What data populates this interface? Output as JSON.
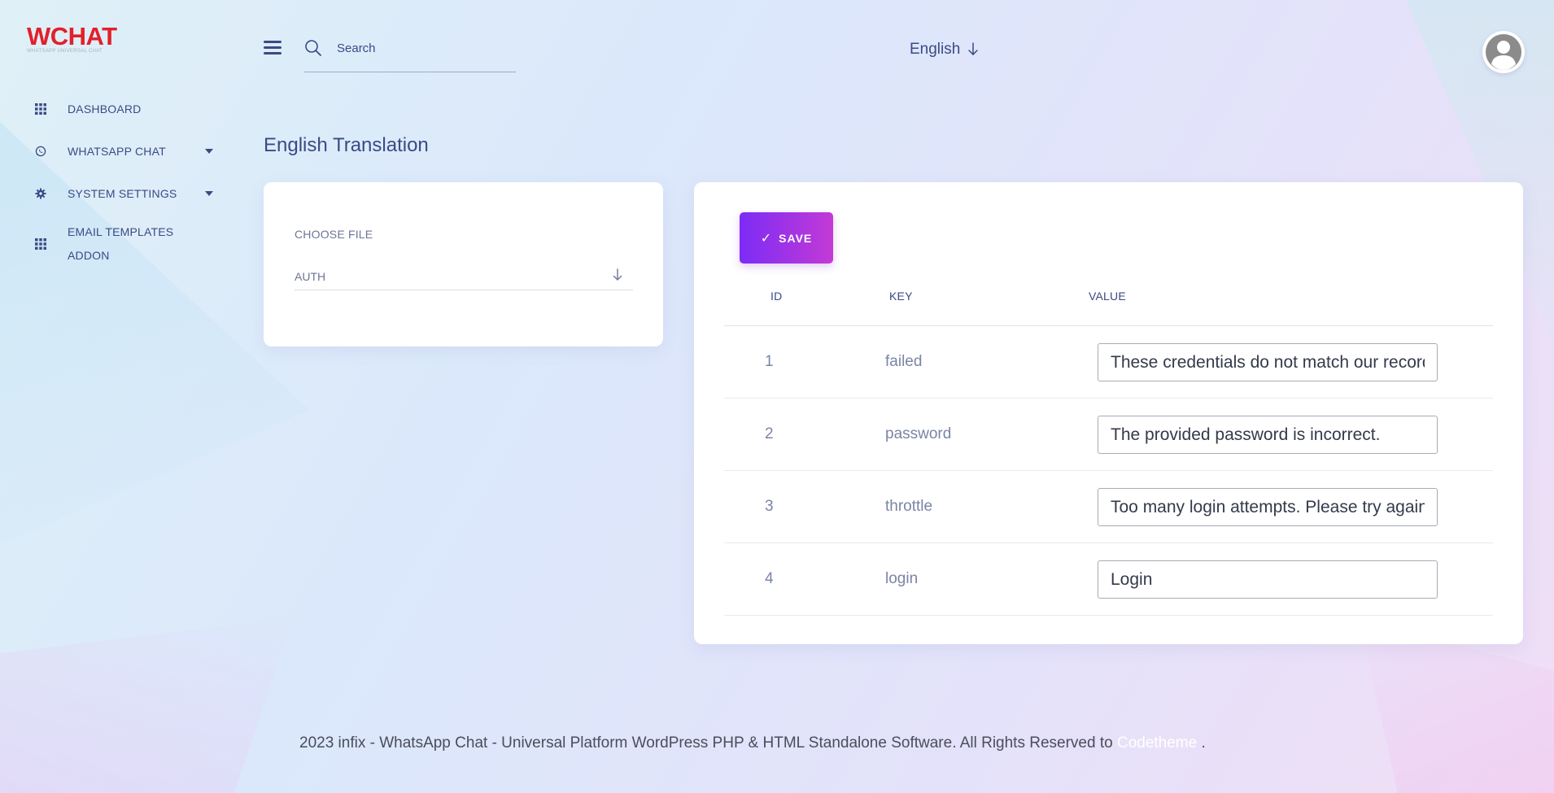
{
  "brand": {
    "title": "WCHAT",
    "subtitle": "WHATSAPP UNIVERSAL CHAT",
    "color": "#e2202a"
  },
  "sidebar": {
    "items": [
      {
        "label": "DASHBOARD",
        "icon": "grid-icon",
        "has_submenu": false
      },
      {
        "label": "WHATSAPP CHAT",
        "icon": "whatsapp-icon",
        "has_submenu": true
      },
      {
        "label": "SYSTEM SETTINGS",
        "icon": "gear-icon",
        "has_submenu": true
      },
      {
        "label": "EMAIL TEMPLATES ADDON",
        "icon": "grid-icon",
        "has_submenu": false
      }
    ]
  },
  "header": {
    "search_placeholder": "Search",
    "language": "English"
  },
  "page": {
    "title": "English Translation"
  },
  "file_picker": {
    "label": "CHOOSE FILE",
    "selected": "AUTH"
  },
  "translations": {
    "save_label": "SAVE",
    "columns": {
      "id": "ID",
      "key": "KEY",
      "value": "VALUE"
    },
    "rows": [
      {
        "id": "1",
        "key": "failed",
        "value": "These credentials do not match our records."
      },
      {
        "id": "2",
        "key": "password",
        "value": "The provided password is incorrect."
      },
      {
        "id": "3",
        "key": "throttle",
        "value": "Too many login attempts. Please try again in :seconds seconds."
      },
      {
        "id": "4",
        "key": "login",
        "value": "Login"
      }
    ]
  },
  "footer": {
    "text": "2023 infix - WhatsApp Chat - Universal Platform WordPress PHP & HTML Standalone Software. All Rights Reserved to",
    "link": "Codetheme",
    "suffix": "."
  },
  "colors": {
    "accent_start": "#7c2cf5",
    "accent_end": "#c33ad6",
    "nav_text": "#3a4a86"
  }
}
